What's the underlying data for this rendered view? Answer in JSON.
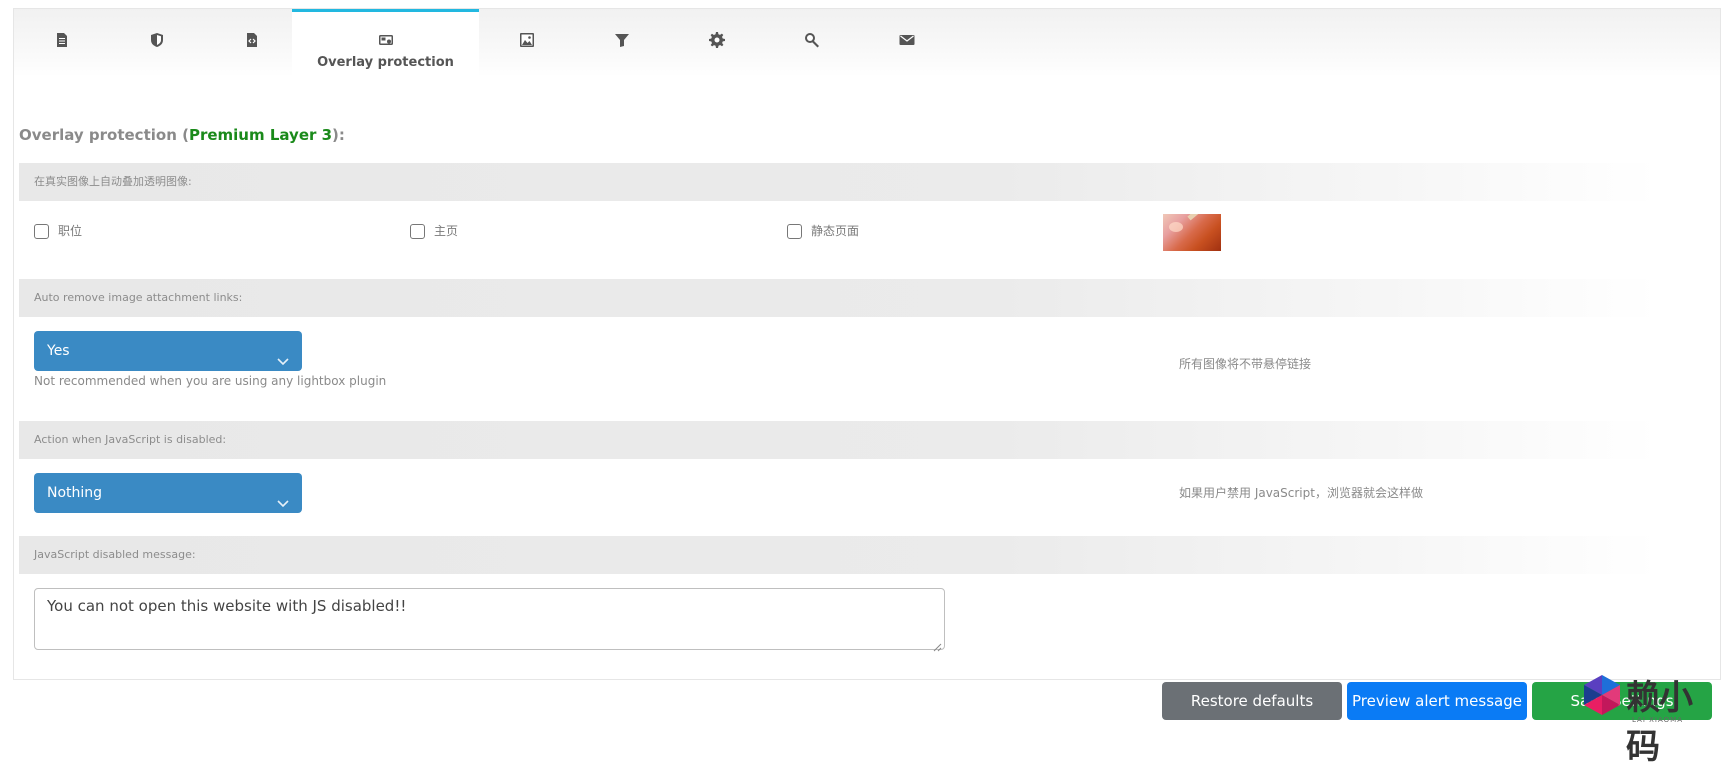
{
  "tabs": [
    {
      "icon": "document-icon",
      "label": ""
    },
    {
      "icon": "shield-icon",
      "label": ""
    },
    {
      "icon": "code-file-icon",
      "label": ""
    },
    {
      "icon": "overlay-icon",
      "label": "Overlay protection",
      "active": true
    },
    {
      "icon": "image-icon",
      "label": ""
    },
    {
      "icon": "filter-icon",
      "label": ""
    },
    {
      "icon": "gear-icon",
      "label": ""
    },
    {
      "icon": "search-icon",
      "label": ""
    },
    {
      "icon": "envelope-icon",
      "label": ""
    }
  ],
  "section": {
    "title_prefix": "Overlay protection (",
    "premium": "Premium Layer 3",
    "title_suffix": "):"
  },
  "overlay": {
    "heading": "在真实图像上自动叠加透明图像:",
    "options": [
      {
        "label": "职位",
        "checked": false
      },
      {
        "label": "主页",
        "checked": false
      },
      {
        "label": "静态页面",
        "checked": false
      }
    ]
  },
  "auto_remove": {
    "heading": "Auto remove image attachment links:",
    "value": "Yes",
    "hint": "Not recommended when you are using any lightbox plugin",
    "note": "所有图像将不带悬停链接"
  },
  "js_action": {
    "heading": "Action when JavaScript is disabled:",
    "value": "Nothing",
    "note": "如果用户禁用 JavaScript，浏览器就会这样做"
  },
  "js_message": {
    "heading": "JavaScript disabled message:",
    "value": "You can not open this website with JS disabled!!"
  },
  "buttons": {
    "restore": "Restore defaults",
    "preview": "Preview alert message",
    "save": "Save Settings"
  },
  "watermark": {
    "text": "赖小码",
    "sub": "LAI XIAOMA"
  },
  "colors": {
    "accent": "#22b8e0",
    "select": "#3a8ac4",
    "premium": "#1a8a1a",
    "restore": "#6b7075",
    "preview": "#0a7bf5",
    "save": "#25a445"
  }
}
